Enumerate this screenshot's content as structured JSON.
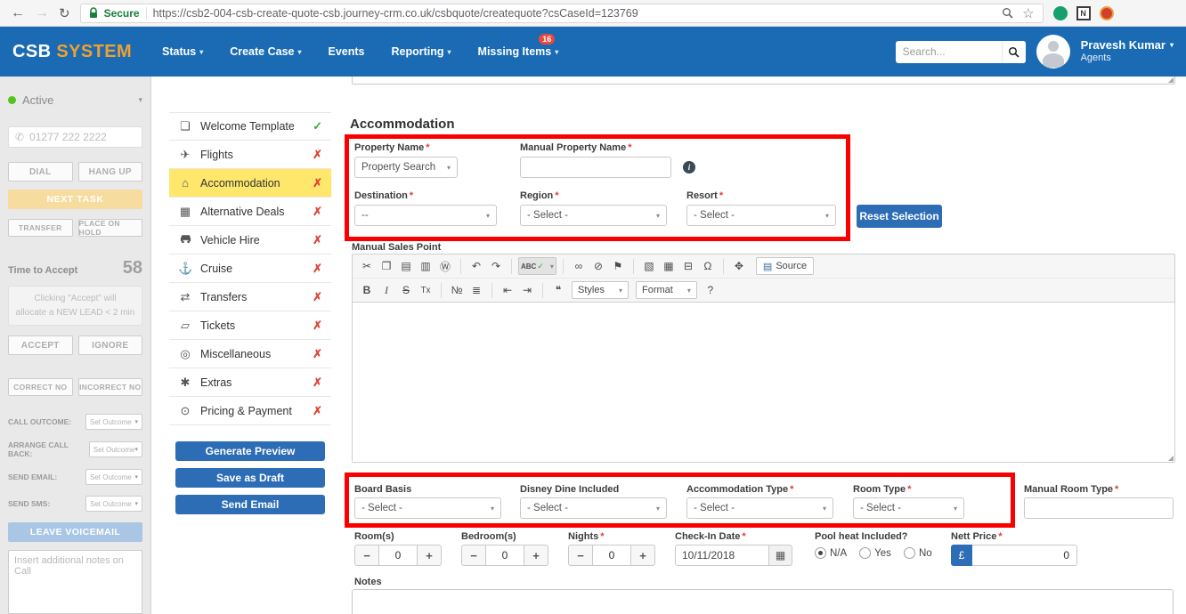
{
  "browser": {
    "secure": "Secure",
    "url": "https://csb2-004-csb-create-quote-csb.journey-crm.co.uk/csbquote/createquote?csCaseId=123769",
    "extension_n": "N"
  },
  "navbar": {
    "brand_primary": "CSB",
    "brand_secondary": "SYSTEM",
    "menu": [
      {
        "label": "Status"
      },
      {
        "label": "Create Case"
      },
      {
        "label": "Events"
      },
      {
        "label": "Reporting"
      },
      {
        "label": "Missing Items",
        "badge": "16"
      }
    ],
    "search_placeholder": "Search...",
    "user": {
      "name": "Pravesh Kumar",
      "role": "Agents"
    }
  },
  "call_panel": {
    "status_label": "Active",
    "phone_number": "01277 222 2222",
    "dial": "DIAL",
    "hang_up": "HANG UP",
    "next_task": "NEXT TASK",
    "transfer": "TRANSFER",
    "place_on_hold": "PLACE ON HOLD",
    "time_to_accept_label": "Time to Accept",
    "time_to_accept_value": "58",
    "accept_note_line1": "Clicking \"Accept\" will",
    "accept_note_line2": "allocate a NEW LEAD < 2 min",
    "accept": "ACCEPT",
    "ignore": "IGNORE",
    "correct_no": "CORRECT NO",
    "incorrect_no": "INCORRECT NO",
    "outcomes": [
      {
        "label": "CALL OUTCOME:",
        "value": "Set Outcome"
      },
      {
        "label": "ARRANGE CALL BACK:",
        "value": "Set Outcome"
      },
      {
        "label": "SEND EMAIL:",
        "value": "Set Outcome"
      },
      {
        "label": "SEND SMS:",
        "value": "Set Outcome"
      }
    ],
    "leave_voicemail": "LEAVE VOICEMAIL",
    "notes_placeholder": "Insert additional notes on Call"
  },
  "quote_menu": {
    "items": [
      {
        "label": "Welcome Template",
        "status": "complete"
      },
      {
        "label": "Flights",
        "status": "incomplete"
      },
      {
        "label": "Accommodation",
        "status": "incomplete"
      },
      {
        "label": "Alternative Deals",
        "status": "incomplete"
      },
      {
        "label": "Vehicle Hire",
        "status": "incomplete"
      },
      {
        "label": "Cruise",
        "status": "incomplete"
      },
      {
        "label": "Transfers",
        "status": "incomplete"
      },
      {
        "label": "Tickets",
        "status": "incomplete"
      },
      {
        "label": "Miscellaneous",
        "status": "incomplete"
      },
      {
        "label": "Extras",
        "status": "incomplete"
      },
      {
        "label": "Pricing & Payment",
        "status": "incomplete"
      }
    ],
    "generate_preview": "Generate Preview",
    "save_as_draft": "Save as Draft",
    "send_email": "Send Email"
  },
  "main": {
    "title": "Accommodation",
    "required_marker": "*",
    "property_name_label": "Property Name",
    "property_search_value": "Property Search",
    "manual_property_label": "Manual Property Name",
    "destination_label": "Destination",
    "destination_value": "--",
    "region_label": "Region",
    "resort_label": "Resort",
    "select_placeholder": "- Select -",
    "reset_button": "Reset Selection",
    "sales_point_label": "Manual Sales Point",
    "board_basis_label": "Board Basis",
    "disney_label": "Disney Dine Included",
    "accom_type_label": "Accommodation Type",
    "room_type_label": "Room Type",
    "manual_room_type_label": "Manual Room Type",
    "rooms_label": "Room(s)",
    "bedrooms_label": "Bedroom(s)",
    "nights_label": "Nights",
    "checkin_label": "Check-In Date",
    "checkin_value": "10/11/2018",
    "pool_label": "Pool heat Included?",
    "pool_options": [
      "N/A",
      "Yes",
      "No"
    ],
    "nett_label": "Nett Price",
    "currency": "£",
    "nett_value": "0",
    "stepper_value": "0",
    "notes_label": "Notes"
  },
  "icons": {
    "back": "←",
    "forward": "→",
    "refresh": "↻",
    "star": "☆",
    "caret": "▾",
    "phone": "✆",
    "check": "✓",
    "cross": "✗",
    "menu_welcome": "❏",
    "menu_flights": "✈",
    "menu_accommodation": "⌂",
    "menu_alt_deals": "▦",
    "menu_cruise": "⚓",
    "menu_transfers": "⇄",
    "menu_tickets": "▱",
    "menu_misc": "◎",
    "menu_extras": "✱",
    "menu_pricing": "⊙",
    "minus": "−",
    "plus": "+",
    "calendar": "▦",
    "info": "i",
    "resize": "◢",
    "toolbar": {
      "cut": "✂",
      "copy": "❐",
      "paste": "▤",
      "paste_text": "▥",
      "paste_word": "Ⓦ",
      "undo": "↶",
      "redo": "↷",
      "spell": "ABC",
      "spell_check": "✓",
      "link": "∞",
      "unlink": "⊘",
      "anchor": "⚑",
      "image": "▧",
      "table": "▦",
      "hr": "⊟",
      "omega": "Ω",
      "maximize": "✥",
      "source_icon": "▤",
      "source_label": "Source",
      "bold": "B",
      "italic": "I",
      "strike": "S",
      "remove_format": "Tx",
      "ol": "№",
      "ul": "≣",
      "outdent": "⇤",
      "indent": "⇥",
      "quote": "❝",
      "styles_label": "Styles",
      "format_label": "Format",
      "about": "?"
    }
  }
}
